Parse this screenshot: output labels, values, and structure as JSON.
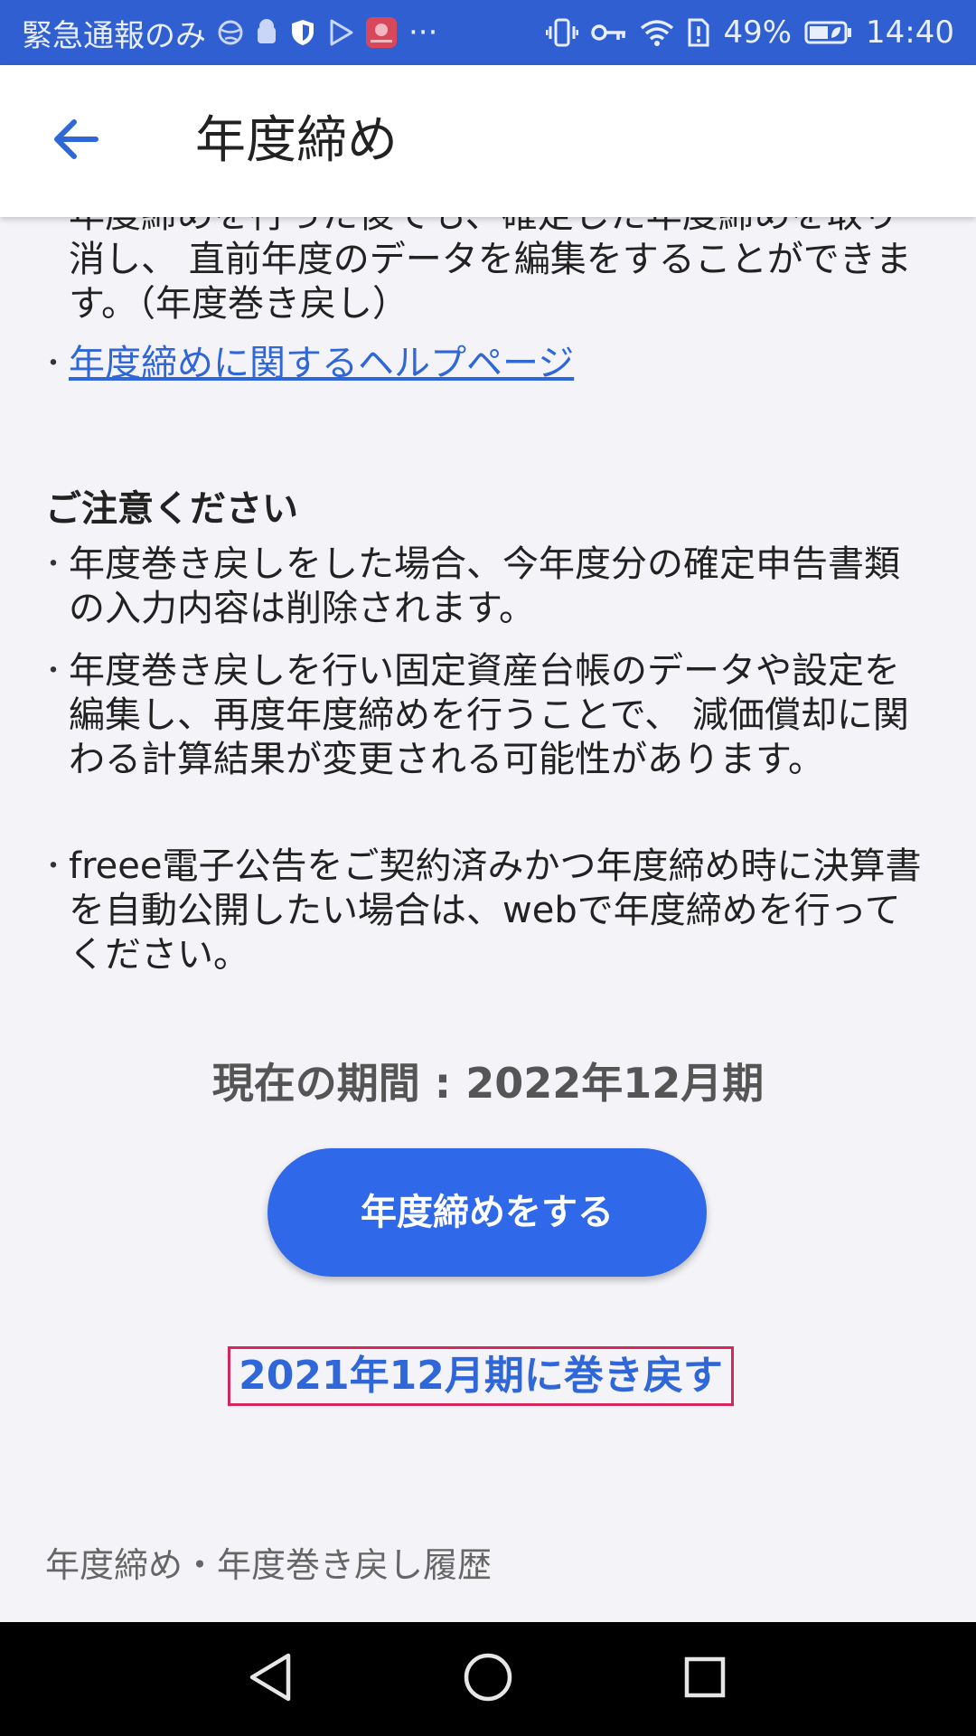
{
  "status_bar": {
    "carrier": "緊急通報のみ",
    "overflow": "···",
    "battery_percent": "49%",
    "time": "14:40",
    "icons_left": [
      "globe-icon",
      "android-icon",
      "shield-icon",
      "play-store-icon",
      "huawei-app-icon"
    ],
    "icons_right": [
      "vibrate-icon",
      "vpn-key-icon",
      "wifi-icon",
      "sim-alert-icon",
      "battery-saver-icon"
    ]
  },
  "app_bar": {
    "title": "年度締め",
    "back_icon": "arrow-left-icon"
  },
  "intro": {
    "cut_text": "年度締めを行った後でも、確定した年度締めを取り消し、 直前年度のデータを編集をすることができます。（年度巻き戻し）",
    "help_link": "年度締めに関するヘルプページ",
    "bullet": "・"
  },
  "notice": {
    "heading": "ご注意ください",
    "items": [
      "年度巻き戻しをした場合、今年度分の確定申告書類の入力内容は削除されます。",
      "年度巻き戻しを行い固定資産台帳のデータや設定を編集し、再度年度締めを行うことで、 減価償却に関わる計算結果が変更される可能性があります。",
      "freee電子公告をご契約済みかつ年度締め時に決算書を自動公開したい場合は、webで年度締めを行ってください。"
    ]
  },
  "period": {
    "label": "現在の期間 : 2022年12月期"
  },
  "actions": {
    "close_year_button": "年度締めをする",
    "rollback_link": "2021年12月期に巻き戻す",
    "history_link": "年度締め・年度巻き戻し履歴"
  },
  "colors": {
    "status_bar": "#2f5fd0",
    "accent": "#2f68e8",
    "link": "#2f66d8",
    "highlight_border": "#d4285c",
    "background": "#f4f4f8"
  },
  "nav_bar": {
    "icons": [
      "back-triangle-icon",
      "home-circle-icon",
      "recents-square-icon"
    ]
  }
}
